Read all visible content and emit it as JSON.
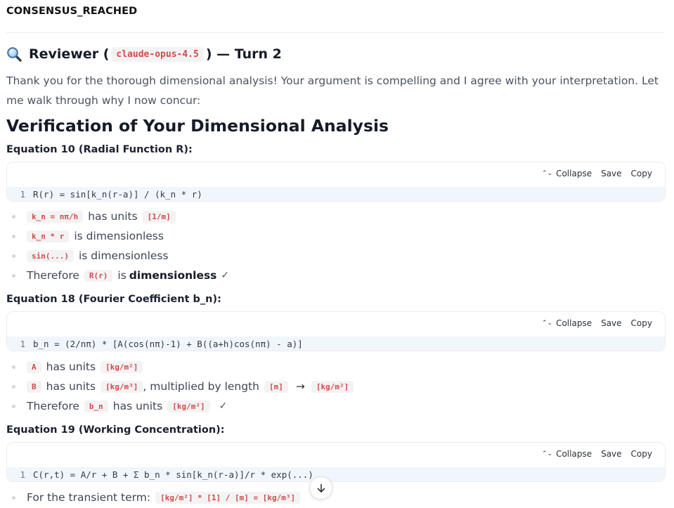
{
  "status": "CONSENSUS_REACHED",
  "reviewer": {
    "icon": "magnifying-glass-icon",
    "prefix": "Reviewer (",
    "model": "claude-opus-4.5",
    "suffix": ") — Turn 2"
  },
  "intro": "Thank you for the thorough dimensional analysis! Your argument is compelling and I agree with your interpretation. Let me walk through why I now concur:",
  "heading": "Verification of Your Dimensional Analysis",
  "toolbar": {
    "collapse": "Collapse",
    "save": "Save",
    "copy": "Copy"
  },
  "sections": [
    {
      "title": "Equation 10 (Radial Function R):",
      "code": {
        "line": "1",
        "text": "R(r) = sin[k_n(r-a)] / (k_n * r)"
      },
      "bullets": [
        {
          "code1": "k_n = nπ/h",
          "text1": "has units",
          "code2": "[1/m]"
        },
        {
          "code1": "k_n * r",
          "text1": "is dimensionless"
        },
        {
          "code1": "sin(...)",
          "text1": "is dimensionless"
        },
        {
          "text0": "Therefore",
          "code1": "R(r)",
          "text1": "is",
          "strong": "dimensionless",
          "check": "✓"
        }
      ]
    },
    {
      "title": "Equation 18 (Fourier Coefficient b_n):",
      "code": {
        "line": "1",
        "text": "b_n = (2/nπ) * [A(cos(nπ)-1) + B((a+h)cos(nπ) - a)]"
      },
      "bullets": [
        {
          "code1": "A",
          "text1": "has units",
          "code2": "[kg/m²]"
        },
        {
          "code1": "B",
          "text1": "has units",
          "code2": "[kg/m³]",
          "text2": ", multiplied by length",
          "code3": "[m]",
          "arrow": "→",
          "code4": "[kg/m²]"
        },
        {
          "text0": "Therefore",
          "code1": "b_n",
          "text1": "has units",
          "code2": "[kg/m²]",
          "check": "✓"
        }
      ]
    },
    {
      "title": "Equation 19 (Working Concentration):",
      "code": {
        "line": "1",
        "text": "C(r,t) = A/r + B + Σ b_n * sin[k_n(r-a)]/r * exp(...)"
      },
      "bullets": [
        {
          "text0": "For the transient term:",
          "code1": "[kg/m²] * [1] / [m] = [kg/m³]"
        }
      ]
    }
  ],
  "scroll_button_icon": "arrow-down-icon"
}
